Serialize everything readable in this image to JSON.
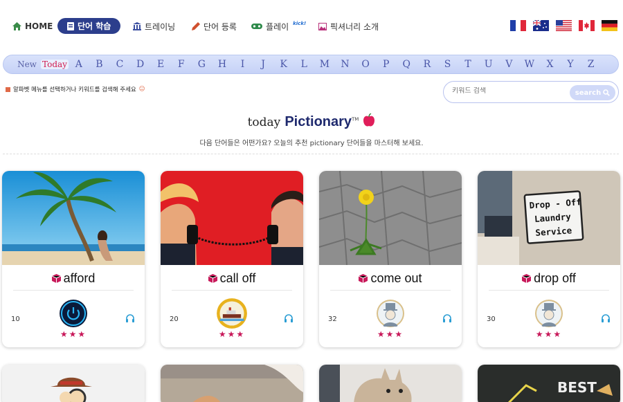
{
  "nav": {
    "home": "HOME",
    "study": "단어 학습",
    "training": "트레이닝",
    "register": "단어 등록",
    "play": "플레이",
    "play_badge": "kick!",
    "about": "픽셔너리 소개"
  },
  "flags": [
    "france-flag",
    "australia-flag",
    "usa-flag",
    "canada-flag",
    "germany-flag"
  ],
  "alphabet": {
    "new": "New",
    "today": "Today",
    "letters": [
      "A",
      "B",
      "C",
      "D",
      "E",
      "F",
      "G",
      "H",
      "I",
      "J",
      "K",
      "L",
      "M",
      "N",
      "O",
      "P",
      "Q",
      "R",
      "S",
      "T",
      "U",
      "V",
      "W",
      "X",
      "Y",
      "Z"
    ]
  },
  "hint": "알파벳 메뉴를 선택하거나 키워드를 검색해 주세요",
  "search": {
    "placeholder": "키워드 검색",
    "button": "search"
  },
  "heading": {
    "prefix": "today",
    "brand": "Pictionary",
    "tm": "TM",
    "subtitle": "다음 단어들은 어떤가요? 오늘의 추천 pictionary 단어들을 마스터해 보세요."
  },
  "cards": [
    {
      "word": "afford",
      "count": "10",
      "stars": "★★★",
      "badge": "power-icon"
    },
    {
      "word": "call off",
      "count": "20",
      "stars": "★★★",
      "badge": "ship-badge"
    },
    {
      "word": "come out",
      "count": "32",
      "stars": "★★★",
      "badge": "avatar-badge"
    },
    {
      "word": "drop off",
      "count": "30",
      "stars": "★★★",
      "badge": "avatar-badge"
    }
  ],
  "image_text": {
    "laundry_sign": [
      "Drop - Off",
      "Laundry",
      "Service"
    ],
    "best_sign": "BEST"
  },
  "colors": {
    "accent": "#2c3e8c",
    "today": "#d01a4e",
    "stars": "#c8195a"
  }
}
